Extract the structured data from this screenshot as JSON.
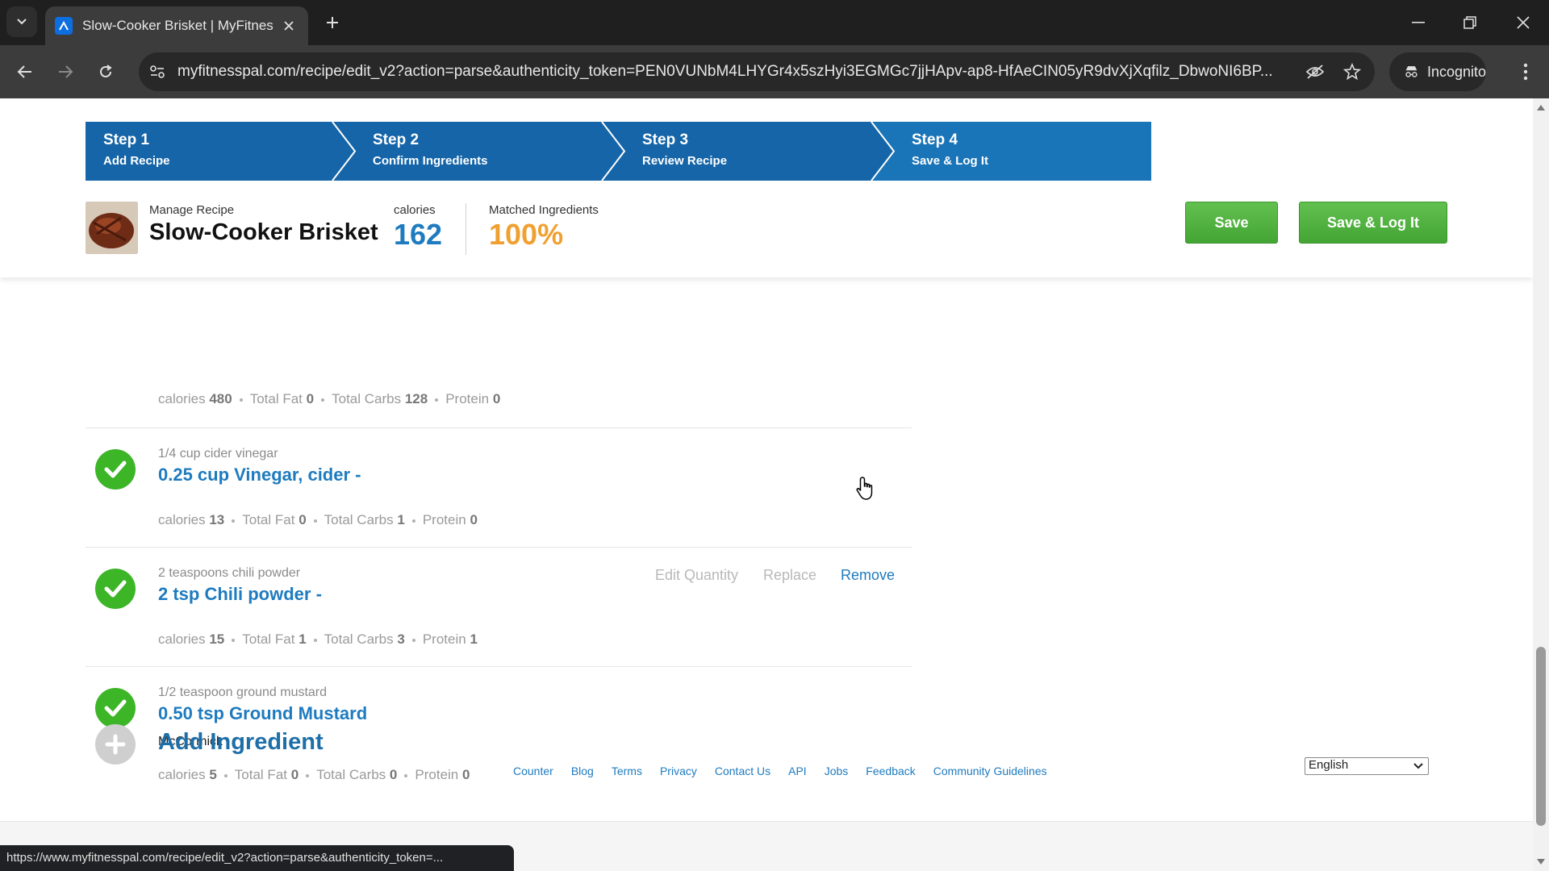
{
  "browser": {
    "tab_title": "Slow-Cooker Brisket | MyFitnes",
    "url": "myfitnesspal.com/recipe/edit_v2?action=parse&authenticity_token=PEN0VUNbM4LHYGr4x5szHyi3EGMGc7jjHApv-ap8-HfAeCIN05yR9dvXjXqfilz_DbwoNI6BP...",
    "incognito_label": "Incognito",
    "status_url": "https://www.myfitnesspal.com/recipe/edit_v2?action=parse&authenticity_token=..."
  },
  "steps": [
    {
      "num": "Step 1",
      "label": "Add Recipe"
    },
    {
      "num": "Step 2",
      "label": "Confirm Ingredients"
    },
    {
      "num": "Step 3",
      "label": "Review Recipe"
    },
    {
      "num": "Step 4",
      "label": "Save & Log It"
    }
  ],
  "header": {
    "manage_label": "Manage Recipe",
    "title": "Slow-Cooker Brisket",
    "calories_label": "calories",
    "calories_value": "162",
    "matched_label": "Matched Ingredients",
    "matched_value": "100%",
    "save_label": "Save",
    "save_log_label": "Save & Log It"
  },
  "nutrient_labels": {
    "calories": "calories",
    "fat": "Total Fat",
    "carbs": "Total Carbs",
    "protein": "Protein"
  },
  "ingredients": [
    {
      "calories": "480",
      "fat": "0",
      "carbs": "128",
      "protein": "0"
    },
    {
      "original": "1/4 cup cider vinegar",
      "name": "0.25 cup Vinegar, cider -",
      "calories": "13",
      "fat": "0",
      "carbs": "1",
      "protein": "0"
    },
    {
      "original": "2 teaspoons chili powder",
      "name": "2 tsp Chili powder -",
      "calories": "15",
      "fat": "1",
      "carbs": "3",
      "protein": "1"
    },
    {
      "original": "1/2 teaspoon ground mustard",
      "name": "0.50 tsp Ground Mustard",
      "brand": "McCormick",
      "calories": "5",
      "fat": "0",
      "carbs": "0",
      "protein": "0"
    }
  ],
  "row_actions": {
    "edit": "Edit Quantity",
    "replace": "Replace",
    "remove": "Remove"
  },
  "add_ingredient_label": "Add Ingredient",
  "footer": {
    "links": [
      "Counter",
      "Blog",
      "Terms",
      "Privacy",
      "Contact Us",
      "API",
      "Jobs",
      "Feedback",
      "Community Guidelines"
    ],
    "language": "English"
  },
  "colors": {
    "step_blue": "#1565a8",
    "step_active": "#1a74b8",
    "link_blue": "#1e7bbf",
    "match_orange": "#f0a030",
    "check_green": "#3cb527",
    "button_green": "#4caf3a"
  }
}
